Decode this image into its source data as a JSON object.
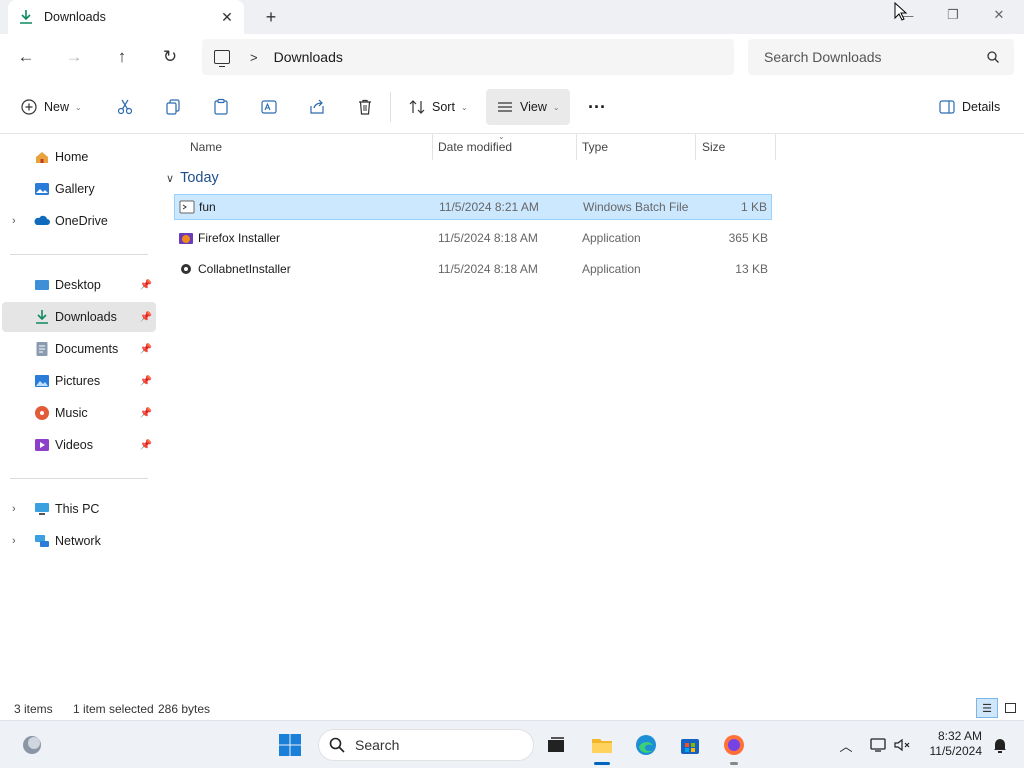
{
  "window": {
    "tab_title": "Downloads",
    "new_tab_label": "+",
    "minimize_label": "—",
    "maximize_label": "❐",
    "close_label": "✕"
  },
  "address": {
    "crumb": "Downloads",
    "separator": ">",
    "search_placeholder": "Search Downloads"
  },
  "commands": {
    "new_label": "New",
    "sort_label": "Sort",
    "view_label": "View",
    "more_label": "···",
    "details_label": "Details"
  },
  "sidebar": {
    "quick": [
      {
        "label": "Home",
        "icon": "home-icon"
      },
      {
        "label": "Gallery",
        "icon": "gallery-icon"
      },
      {
        "label": "OneDrive",
        "icon": "onedrive-icon"
      }
    ],
    "pinned": [
      {
        "label": "Desktop",
        "icon": "desktop-icon"
      },
      {
        "label": "Downloads",
        "icon": "downloads-icon"
      },
      {
        "label": "Documents",
        "icon": "documents-icon"
      },
      {
        "label": "Pictures",
        "icon": "pictures-icon"
      },
      {
        "label": "Music",
        "icon": "music-icon"
      },
      {
        "label": "Videos",
        "icon": "videos-icon"
      }
    ],
    "drives": [
      {
        "label": "This PC",
        "icon": "this-pc-icon"
      },
      {
        "label": "Network",
        "icon": "network-icon"
      }
    ]
  },
  "list": {
    "columns": [
      "Name",
      "Date modified",
      "Type",
      "Size"
    ],
    "group_label": "Today",
    "rows": [
      {
        "name": "fun",
        "date": "11/5/2024 8:21 AM",
        "type": "Windows Batch File",
        "size": "1 KB"
      },
      {
        "name": "Firefox Installer",
        "date": "11/5/2024 8:18 AM",
        "type": "Application",
        "size": "365 KB"
      },
      {
        "name": "CollabnetInstaller",
        "date": "11/5/2024 8:18 AM",
        "type": "Application",
        "size": "13 KB"
      }
    ]
  },
  "status": {
    "item_count": "3 items",
    "selection": "1 item selected",
    "selection_size": "286 bytes"
  },
  "taskbar": {
    "search_label": "Search",
    "time": "8:32 AM",
    "date": "11/5/2024"
  },
  "colors": {
    "accent": "#0067c0",
    "selection_bg": "#cce8ff",
    "selection_border": "#99d1ff"
  }
}
